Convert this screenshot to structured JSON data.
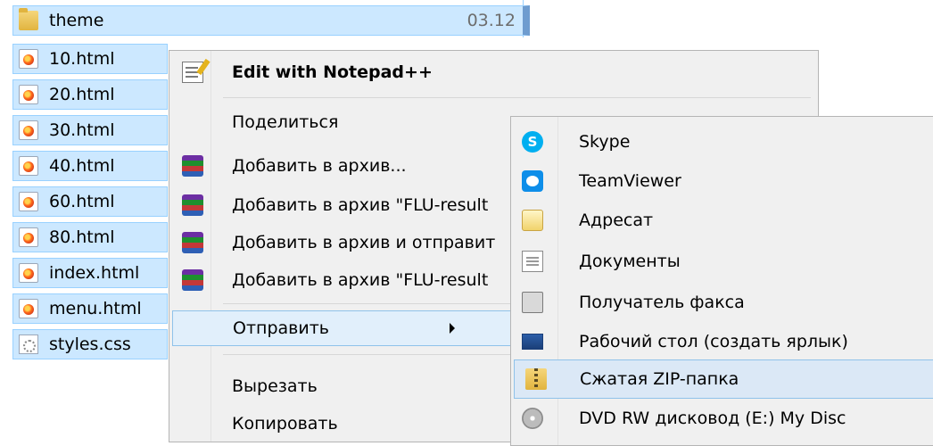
{
  "files": [
    {
      "name": "theme",
      "date": "03.12",
      "icon": "folder-icon"
    },
    {
      "name": "10.html",
      "icon": "firefox-html-icon"
    },
    {
      "name": "20.html",
      "icon": "firefox-html-icon"
    },
    {
      "name": "30.html",
      "icon": "firefox-html-icon"
    },
    {
      "name": "40.html",
      "icon": "firefox-html-icon"
    },
    {
      "name": "60.html",
      "icon": "firefox-html-icon"
    },
    {
      "name": "80.html",
      "icon": "firefox-html-icon"
    },
    {
      "name": "index.html",
      "icon": "firefox-html-icon"
    },
    {
      "name": "menu.html",
      "icon": "firefox-html-icon"
    },
    {
      "name": "styles.css",
      "icon": "css-file-icon"
    }
  ],
  "context_menu": {
    "edit_notepad": "Edit with Notepad++",
    "share": "Поделиться",
    "add_archive": "Добавить в архив...",
    "add_archive_named": "Добавить в архив \"FLU-result",
    "add_archive_send": "Добавить в архив и отправит",
    "add_archive_named_send": "Добавить в архив \"FLU-result",
    "send_to": "Отправить",
    "cut": "Вырезать",
    "copy": "Копировать"
  },
  "send_to_menu": {
    "skype": "Skype",
    "teamviewer": "TeamViewer",
    "recipient": "Адресат",
    "documents": "Документы",
    "fax": "Получатель факса",
    "desktop": "Рабочий стол (создать ярлык)",
    "zip": "Сжатая ZIP-папка",
    "dvd": "DVD RW дисковод (E:) My Disc"
  },
  "colors": {
    "selection": "#cce8ff",
    "selection_border": "#99d1ff",
    "menu_bg": "#f0f0f0",
    "menu_highlight": "#dbe8f6"
  }
}
